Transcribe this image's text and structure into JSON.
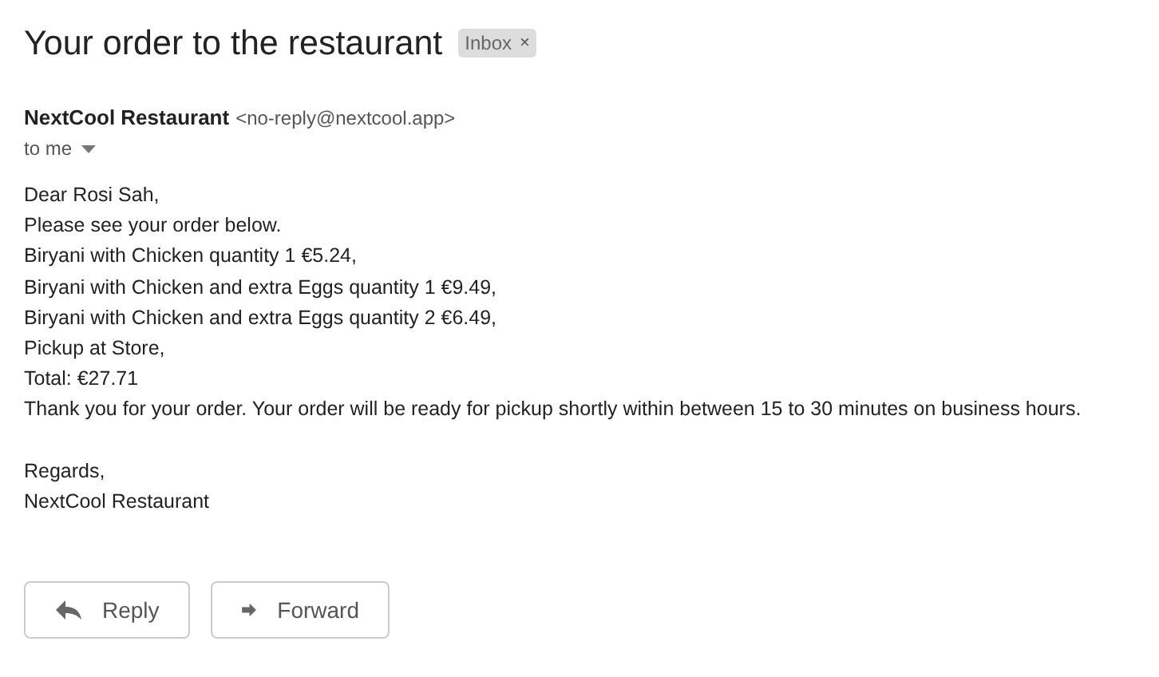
{
  "subject": "Your order to the restaurant",
  "label": {
    "text": "Inbox",
    "close": "×"
  },
  "sender": {
    "name": "NextCool Restaurant",
    "email": "<no-reply@nextcool.app>",
    "recipient": "to me"
  },
  "body": [
    "Dear Rosi Sah,",
    "Please see your order below.",
    "Biryani with Chicken quantity 1 €5.24,",
    "Biryani with Chicken and extra Eggs quantity 1 €9.49,",
    "Biryani with Chicken and extra Eggs quantity 2 €6.49,",
    "Pickup at Store,",
    "Total: €27.71",
    "Thank you for your order. Your order will be ready for pickup shortly within between 15 to 30 minutes on business hours."
  ],
  "signature": [
    "Regards,",
    "NextCool Restaurant"
  ],
  "actions": [
    {
      "kind": "reply",
      "label": "Reply"
    },
    {
      "kind": "forward",
      "label": "Forward"
    }
  ]
}
